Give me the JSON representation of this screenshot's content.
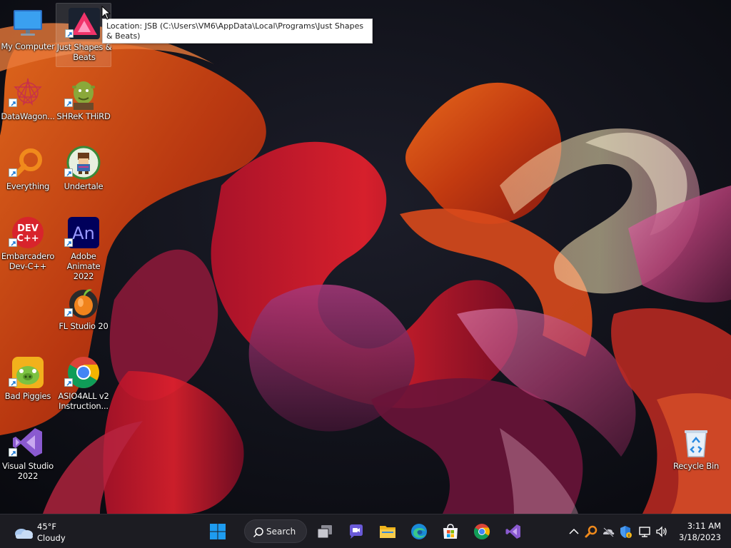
{
  "desktop": {
    "icons": [
      {
        "label": "My Computer"
      },
      {
        "label": "Just Shapes & Beats"
      },
      {
        "label": "DataWagon..."
      },
      {
        "label": "SHReK THiRD"
      },
      {
        "label": "Everything"
      },
      {
        "label": "Undertale"
      },
      {
        "label": "Embarcadero Dev-C++"
      },
      {
        "label": "Adobe Animate 2022"
      },
      {
        "label": "FL Studio 20"
      },
      {
        "label": "Bad Piggies"
      },
      {
        "label": "ASIO4ALL v2 Instruction..."
      },
      {
        "label": "Visual Studio 2022"
      },
      {
        "label": "Recycle Bin"
      }
    ],
    "tooltip": "Location: JSB (C:\\Users\\VM6\\AppData\\Local\\Programs\\Just Shapes & Beats)",
    "devcpp_logo_line1": "DEV",
    "devcpp_logo_line2": "C++",
    "animate_logo": "An"
  },
  "taskbar": {
    "weather": {
      "temp": "45°F",
      "condition": "Cloudy"
    },
    "search_label": "Search",
    "clock": {
      "time": "3:11 AM",
      "date": "3/18/2023"
    }
  },
  "colors": {
    "taskbar_bg": "#1c1c22",
    "win_blue": "#1e9cf0",
    "tooltip_bg": "#ffffff"
  }
}
